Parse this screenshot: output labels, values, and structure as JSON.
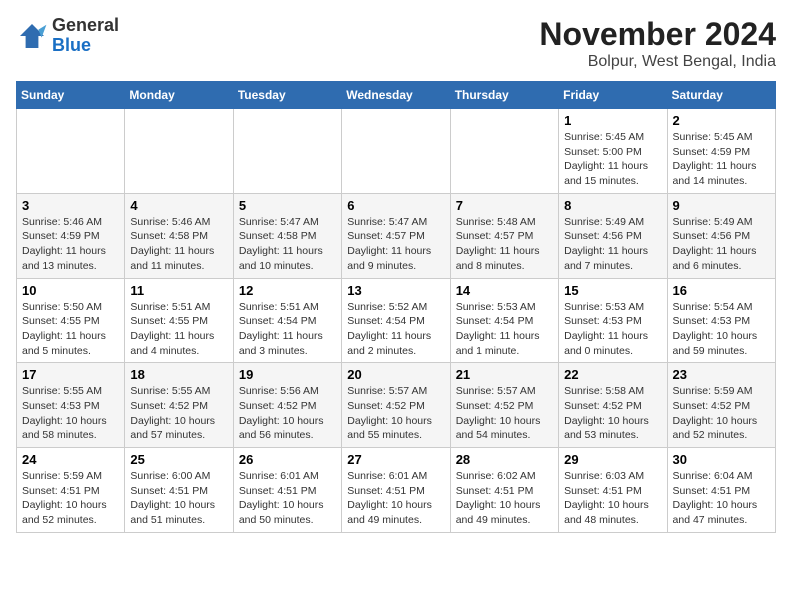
{
  "logo": {
    "general": "General",
    "blue": "Blue"
  },
  "title": "November 2024",
  "location": "Bolpur, West Bengal, India",
  "weekdays": [
    "Sunday",
    "Monday",
    "Tuesday",
    "Wednesday",
    "Thursday",
    "Friday",
    "Saturday"
  ],
  "weeks": [
    [
      {
        "day": "",
        "info": ""
      },
      {
        "day": "",
        "info": ""
      },
      {
        "day": "",
        "info": ""
      },
      {
        "day": "",
        "info": ""
      },
      {
        "day": "",
        "info": ""
      },
      {
        "day": "1",
        "info": "Sunrise: 5:45 AM\nSunset: 5:00 PM\nDaylight: 11 hours and 15 minutes."
      },
      {
        "day": "2",
        "info": "Sunrise: 5:45 AM\nSunset: 4:59 PM\nDaylight: 11 hours and 14 minutes."
      }
    ],
    [
      {
        "day": "3",
        "info": "Sunrise: 5:46 AM\nSunset: 4:59 PM\nDaylight: 11 hours and 13 minutes."
      },
      {
        "day": "4",
        "info": "Sunrise: 5:46 AM\nSunset: 4:58 PM\nDaylight: 11 hours and 11 minutes."
      },
      {
        "day": "5",
        "info": "Sunrise: 5:47 AM\nSunset: 4:58 PM\nDaylight: 11 hours and 10 minutes."
      },
      {
        "day": "6",
        "info": "Sunrise: 5:47 AM\nSunset: 4:57 PM\nDaylight: 11 hours and 9 minutes."
      },
      {
        "day": "7",
        "info": "Sunrise: 5:48 AM\nSunset: 4:57 PM\nDaylight: 11 hours and 8 minutes."
      },
      {
        "day": "8",
        "info": "Sunrise: 5:49 AM\nSunset: 4:56 PM\nDaylight: 11 hours and 7 minutes."
      },
      {
        "day": "9",
        "info": "Sunrise: 5:49 AM\nSunset: 4:56 PM\nDaylight: 11 hours and 6 minutes."
      }
    ],
    [
      {
        "day": "10",
        "info": "Sunrise: 5:50 AM\nSunset: 4:55 PM\nDaylight: 11 hours and 5 minutes."
      },
      {
        "day": "11",
        "info": "Sunrise: 5:51 AM\nSunset: 4:55 PM\nDaylight: 11 hours and 4 minutes."
      },
      {
        "day": "12",
        "info": "Sunrise: 5:51 AM\nSunset: 4:54 PM\nDaylight: 11 hours and 3 minutes."
      },
      {
        "day": "13",
        "info": "Sunrise: 5:52 AM\nSunset: 4:54 PM\nDaylight: 11 hours and 2 minutes."
      },
      {
        "day": "14",
        "info": "Sunrise: 5:53 AM\nSunset: 4:54 PM\nDaylight: 11 hours and 1 minute."
      },
      {
        "day": "15",
        "info": "Sunrise: 5:53 AM\nSunset: 4:53 PM\nDaylight: 11 hours and 0 minutes."
      },
      {
        "day": "16",
        "info": "Sunrise: 5:54 AM\nSunset: 4:53 PM\nDaylight: 10 hours and 59 minutes."
      }
    ],
    [
      {
        "day": "17",
        "info": "Sunrise: 5:55 AM\nSunset: 4:53 PM\nDaylight: 10 hours and 58 minutes."
      },
      {
        "day": "18",
        "info": "Sunrise: 5:55 AM\nSunset: 4:52 PM\nDaylight: 10 hours and 57 minutes."
      },
      {
        "day": "19",
        "info": "Sunrise: 5:56 AM\nSunset: 4:52 PM\nDaylight: 10 hours and 56 minutes."
      },
      {
        "day": "20",
        "info": "Sunrise: 5:57 AM\nSunset: 4:52 PM\nDaylight: 10 hours and 55 minutes."
      },
      {
        "day": "21",
        "info": "Sunrise: 5:57 AM\nSunset: 4:52 PM\nDaylight: 10 hours and 54 minutes."
      },
      {
        "day": "22",
        "info": "Sunrise: 5:58 AM\nSunset: 4:52 PM\nDaylight: 10 hours and 53 minutes."
      },
      {
        "day": "23",
        "info": "Sunrise: 5:59 AM\nSunset: 4:52 PM\nDaylight: 10 hours and 52 minutes."
      }
    ],
    [
      {
        "day": "24",
        "info": "Sunrise: 5:59 AM\nSunset: 4:51 PM\nDaylight: 10 hours and 52 minutes."
      },
      {
        "day": "25",
        "info": "Sunrise: 6:00 AM\nSunset: 4:51 PM\nDaylight: 10 hours and 51 minutes."
      },
      {
        "day": "26",
        "info": "Sunrise: 6:01 AM\nSunset: 4:51 PM\nDaylight: 10 hours and 50 minutes."
      },
      {
        "day": "27",
        "info": "Sunrise: 6:01 AM\nSunset: 4:51 PM\nDaylight: 10 hours and 49 minutes."
      },
      {
        "day": "28",
        "info": "Sunrise: 6:02 AM\nSunset: 4:51 PM\nDaylight: 10 hours and 49 minutes."
      },
      {
        "day": "29",
        "info": "Sunrise: 6:03 AM\nSunset: 4:51 PM\nDaylight: 10 hours and 48 minutes."
      },
      {
        "day": "30",
        "info": "Sunrise: 6:04 AM\nSunset: 4:51 PM\nDaylight: 10 hours and 47 minutes."
      }
    ]
  ]
}
